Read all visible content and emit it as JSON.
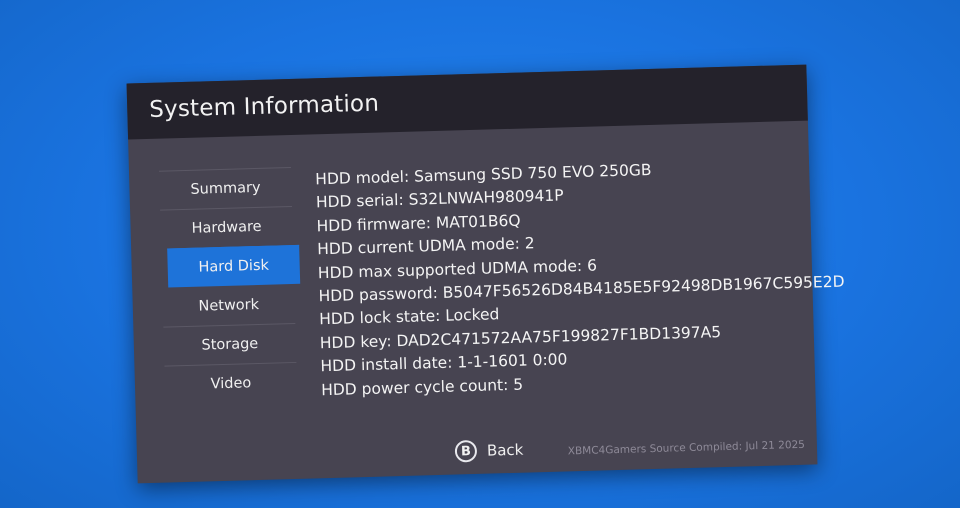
{
  "window": {
    "title": "System Information"
  },
  "sidebar": {
    "items": [
      {
        "label": "Summary"
      },
      {
        "label": "Hardware"
      },
      {
        "label": "Hard Disk",
        "selected": true
      },
      {
        "label": "Network"
      },
      {
        "label": "Storage"
      },
      {
        "label": "Video"
      }
    ]
  },
  "info": {
    "lines": [
      "HDD model: Samsung SSD 750 EVO 250GB",
      "HDD serial: S32LNWAH980941P",
      "HDD firmware: MAT01B6Q",
      "HDD current UDMA mode: 2",
      "HDD max supported UDMA mode: 6",
      "HDD password: B5047F56526D84B4185E5F92498DB1967C595E2D",
      "HDD lock state: Locked",
      "HDD key: DAD2C471572AA75F199827F1BD1397A5",
      "HDD install date: 1-1-1601 0:00",
      "HDD power cycle count: 5"
    ]
  },
  "back": {
    "icon_letter": "B",
    "label": "Back"
  },
  "footer": {
    "build": "XBMC4Gamers Source Compiled: Jul 21 2025"
  },
  "colors": {
    "background": "#1877e6",
    "panel": "#474451",
    "titlebar": "#24222b",
    "selected": "#1e73d9"
  }
}
